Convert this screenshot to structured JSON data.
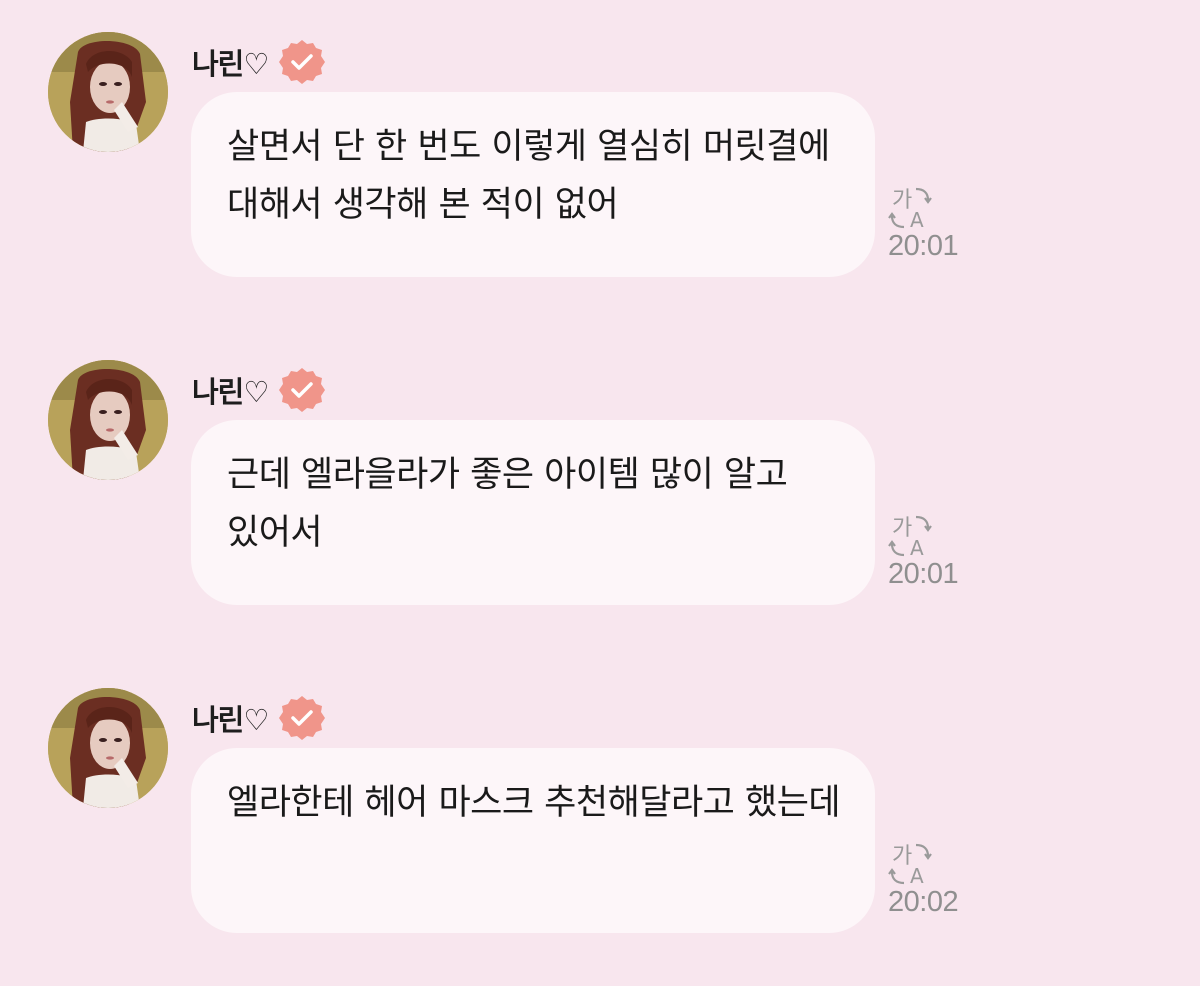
{
  "messages": [
    {
      "sender": "나린♡",
      "text": "살면서 단 한 번도 이렇게 열심히 머릿결에 대해서 생각해 본 적이 없어",
      "time": "20:01"
    },
    {
      "sender": "나린♡",
      "text": "근데 엘라을라가 좋은 아이템 많이 알고 있어서",
      "time": "20:01"
    },
    {
      "sender": "나린♡",
      "text": "엘라한테 헤어 마스크 추천해달라고 했는데",
      "time": "20:02"
    }
  ],
  "icons": {
    "avatar": "profile-photo",
    "verified": "verified-badge-icon",
    "translate": "translate-icon"
  },
  "colors": {
    "background": "#f8e6ee",
    "bubble": "#fdf6f9",
    "verified_badge": "#f0958a",
    "timestamp": "#8f8f8f"
  }
}
